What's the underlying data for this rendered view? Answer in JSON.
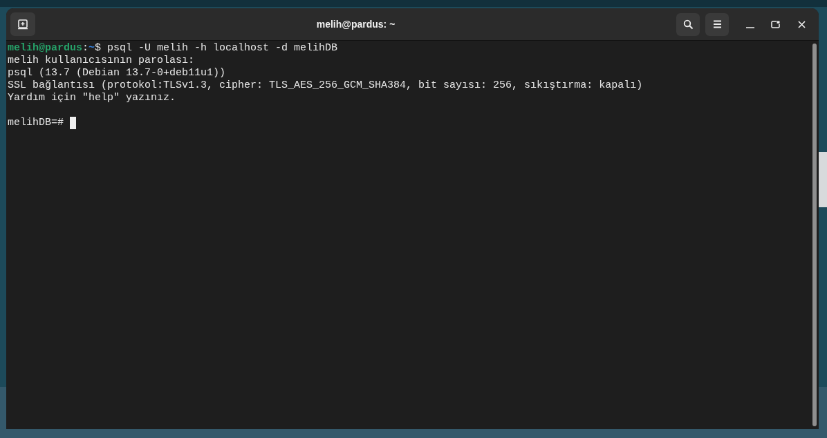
{
  "window": {
    "title": "melih@pardus: ~"
  },
  "terminal": {
    "lines": [
      {
        "kind": "shell_prompt",
        "user_host": "melih@pardus",
        "separator": ":",
        "path": "~",
        "command": "$ psql -U melih -h localhost -d melihDB"
      },
      {
        "kind": "output",
        "text": "melih kullanıcısının parolası:"
      },
      {
        "kind": "output",
        "text": "psql (13.7 (Debian 13.7-0+deb11u1))"
      },
      {
        "kind": "output",
        "text": "SSL bağlantısı (protokol:TLSv1.3, cipher: TLS_AES_256_GCM_SHA384, bit sayısı: 256, sıkıştırma: kapalı)"
      },
      {
        "kind": "output",
        "text": "Yardım için \"help\" yazınız."
      },
      {
        "kind": "blank"
      },
      {
        "kind": "psql_prompt",
        "text": "melihDB=#"
      }
    ]
  }
}
